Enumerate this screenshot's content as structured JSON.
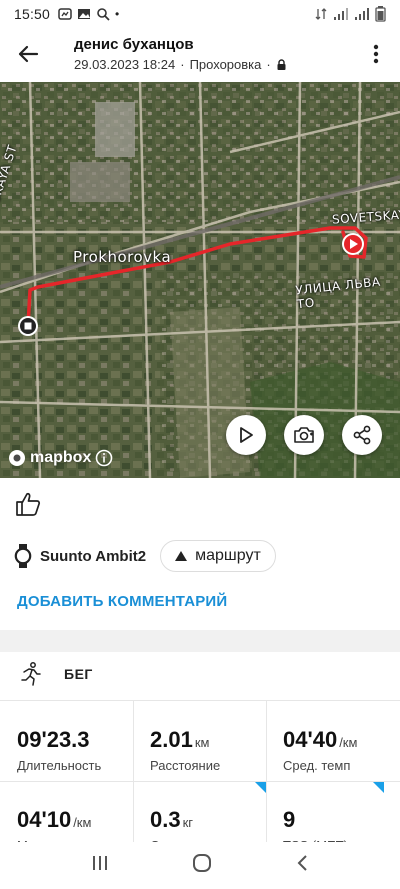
{
  "status_bar": {
    "time": "15:50",
    "dot": "•"
  },
  "header": {
    "athlete": "денис буханцов",
    "datetime": "29.03.2023 18:24",
    "separator": "·",
    "location": "Прохоровка",
    "separator2": "·"
  },
  "map": {
    "labels": {
      "street_left": "ORSKAYA ST",
      "town": "Prokhorovka",
      "street_right": "SOVETSKAY",
      "street_bottom": "УЛИЦА ЛЬВА ТО"
    },
    "attribution": "mapbox",
    "route_color": "#e5262a"
  },
  "activity": {
    "device": "Suunto Ambit2",
    "route_chip": "маршрут",
    "add_comment": "ДОБАВИТЬ КОММЕНТАРИЙ",
    "sport": "БЕГ"
  },
  "stats": [
    {
      "value": "09'23.3",
      "unit": "",
      "label": "Длительность"
    },
    {
      "value": "2.01",
      "unit": "км",
      "label": "Расстояние"
    },
    {
      "value": "04'40",
      "unit": "/км",
      "label": "Сред. темп"
    },
    {
      "value": "04'10",
      "unit": "/км",
      "label": "Макс. темп"
    },
    {
      "value": "0.3",
      "unit": "кг",
      "label": "Сжигание жира"
    },
    {
      "value": "9",
      "unit": "",
      "label": "TSS (MET)"
    }
  ],
  "colors": {
    "accent": "#1a8fd6",
    "corner_marker": "#1aa0e8"
  }
}
